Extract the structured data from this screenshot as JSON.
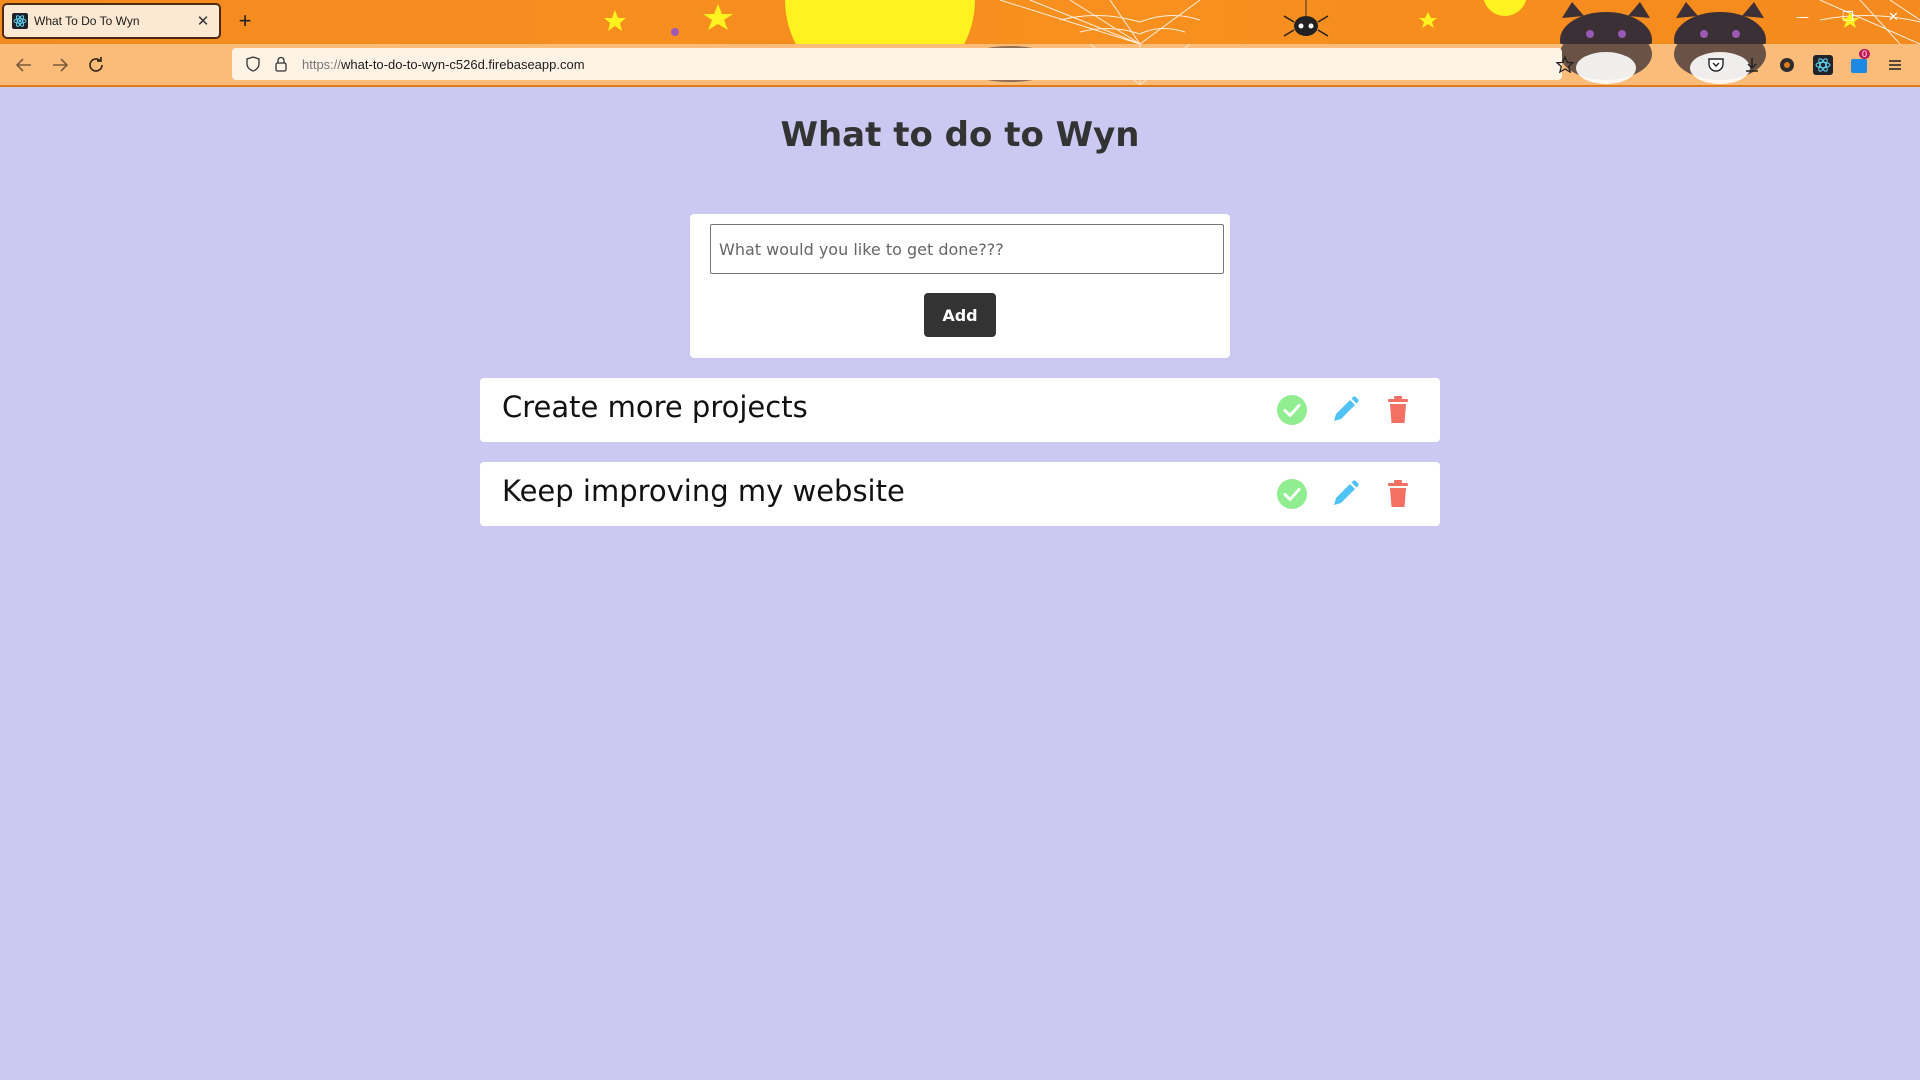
{
  "browser": {
    "tab_title": "What To Do To Wyn",
    "tab_close": "✕",
    "new_tab": "+",
    "url_scheme": "https://",
    "url_host": "what-to-do-to-wyn-c526d.firebaseapp.com",
    "extension_badge": "0",
    "theme_colors": {
      "tabbar": "#f58b20",
      "navbar": "#fbbc7a"
    }
  },
  "page": {
    "title": "What to do to Wyn",
    "background": "#cbc9f1",
    "form": {
      "placeholder": "What would you like to get done???",
      "value": "",
      "add_label": "Add"
    },
    "todos": [
      {
        "text": "Create more projects"
      },
      {
        "text": "Keep improving my website"
      }
    ],
    "action_icons": {
      "complete": {
        "icon": "check-circle-icon",
        "color": "#90ee90"
      },
      "edit": {
        "icon": "pencil-icon",
        "color": "#4fc3f7"
      },
      "delete": {
        "icon": "trash-icon",
        "color": "#f47063"
      }
    }
  }
}
